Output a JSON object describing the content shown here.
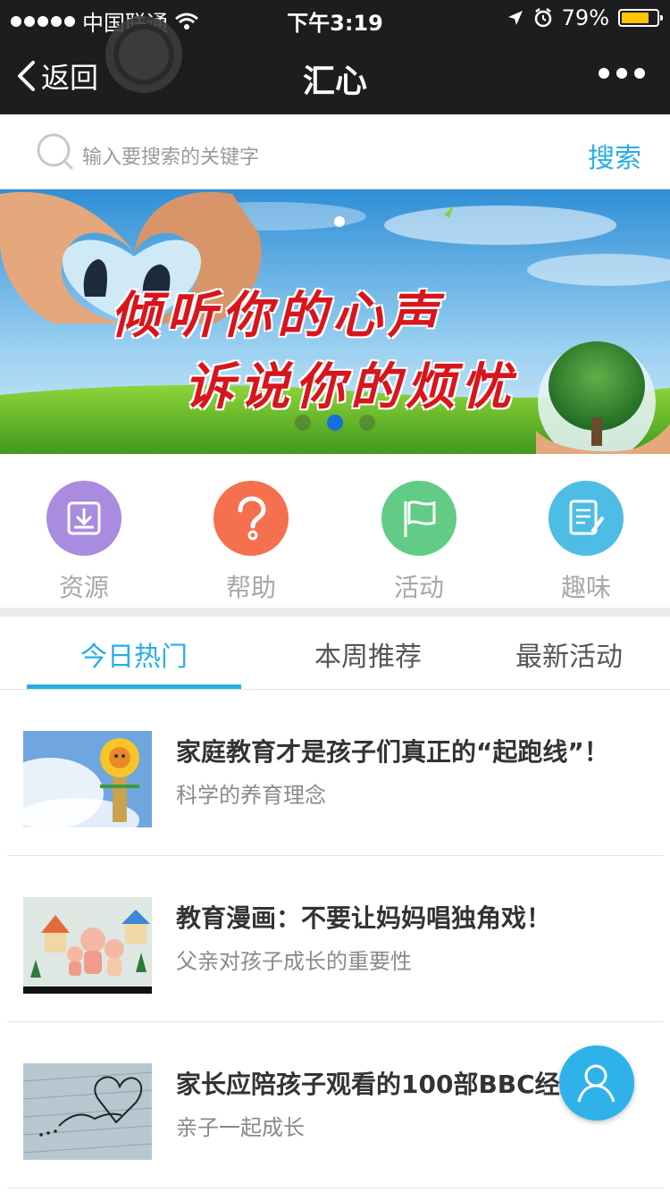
{
  "status_bar": {
    "carrier": "中国联通",
    "time": "下午3:19",
    "battery_percent": "79%",
    "battery_level": 0.79,
    "icons": [
      "signal-dots-icon",
      "wifi-icon",
      "location-arrow-icon",
      "alarm-icon",
      "battery-icon"
    ]
  },
  "nav": {
    "back_label": "返回",
    "title": "汇心",
    "more_icon": "more-dots-icon"
  },
  "search": {
    "placeholder": "输入要搜索的关键字",
    "button_label": "搜索"
  },
  "banner": {
    "line1": "倾听你的心声",
    "line2": "诉说你的烦忧",
    "pages": 3,
    "active_page": 2
  },
  "categories": [
    {
      "label": "资源",
      "icon": "download-box-icon",
      "color": "#a98be0"
    },
    {
      "label": "帮助",
      "icon": "question-icon",
      "color": "#f4704f"
    },
    {
      "label": "活动",
      "icon": "flag-icon",
      "color": "#62cc86"
    },
    {
      "label": "趣味",
      "icon": "note-edit-icon",
      "color": "#4dbde6"
    }
  ],
  "tabs": [
    {
      "label": "今日热门",
      "active": true
    },
    {
      "label": "本周推荐",
      "active": false
    },
    {
      "label": "最新活动",
      "active": false
    }
  ],
  "articles": [
    {
      "title": "家庭教育才是孩子们真正的“起跑线”！",
      "subtitle": "科学的养育理念",
      "thumb": "sunflower-doll"
    },
    {
      "title": "教育漫画：不要让妈妈唱独角戏！",
      "subtitle": "父亲对孩子成长的重要性",
      "thumb": "clay-family"
    },
    {
      "title": "家长应陪孩子观看的100部BBC经典...",
      "subtitle": "亲子一起成长",
      "thumb": "love-paper"
    }
  ],
  "fab_icon": "user-icon",
  "colors": {
    "accent": "#27aee6",
    "topbar": "#1d1d1f"
  }
}
